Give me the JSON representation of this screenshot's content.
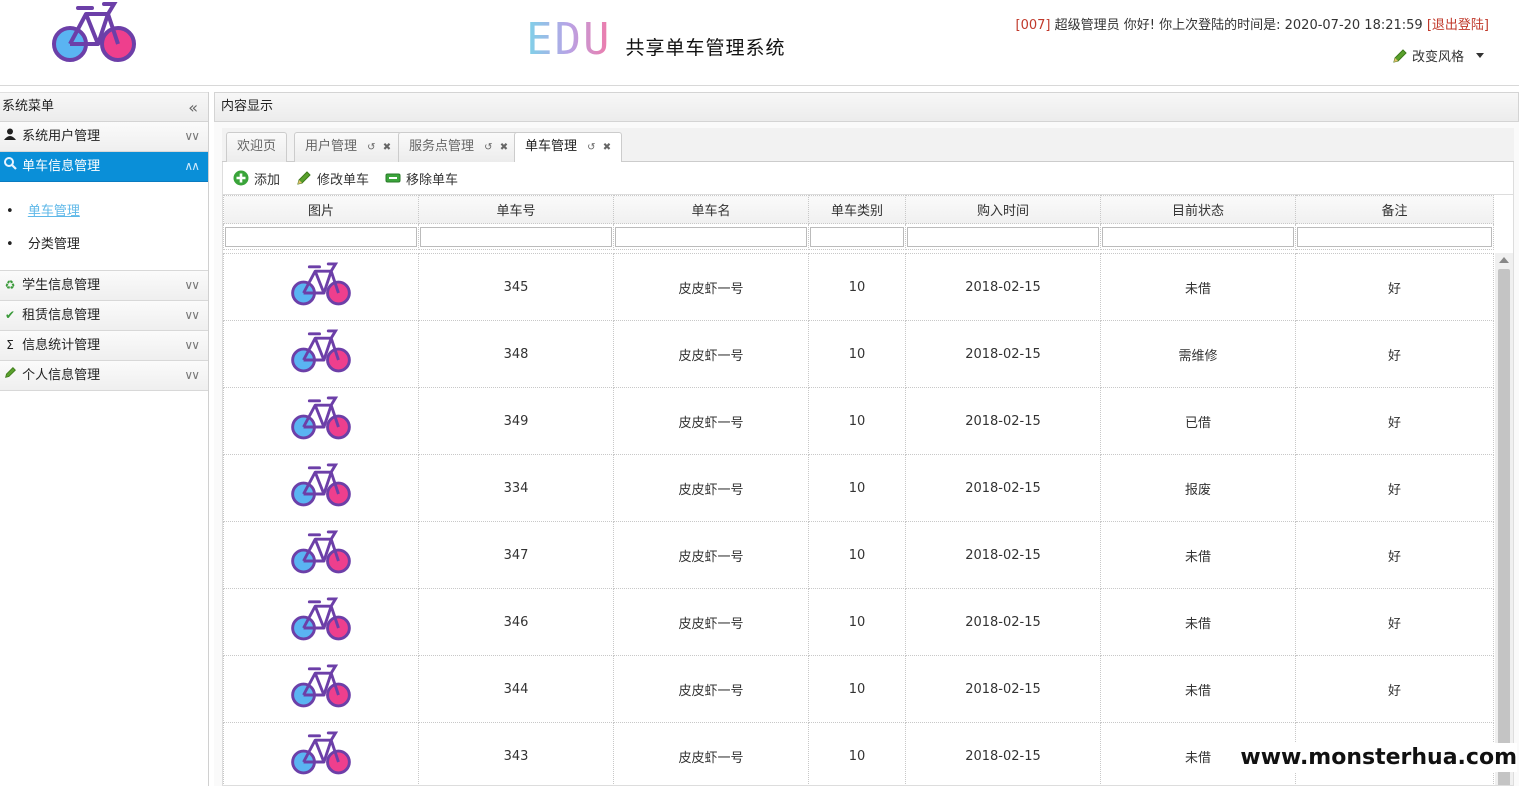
{
  "header": {
    "brand_edu": "EDU",
    "brand_title": "共享单车管理系统",
    "user_id": "[007]",
    "user_greeting": "超级管理员 你好! 你上次登陆的时间是: 2020-07-20 18:21:59",
    "logout_label": "[退出登陆]",
    "style_label": "改变风格"
  },
  "sidebar": {
    "title": "系统菜单",
    "items": [
      {
        "label": "系统用户管理",
        "icon": "user-icon"
      },
      {
        "label": "单车信息管理",
        "icon": "search-icon"
      },
      {
        "label": "学生信息管理",
        "icon": "refresh-icon"
      },
      {
        "label": "租赁信息管理",
        "icon": "check-icon"
      },
      {
        "label": "信息统计管理",
        "icon": "sigma-icon"
      },
      {
        "label": "个人信息管理",
        "icon": "pencil-icon"
      }
    ],
    "submenu": [
      {
        "label": "单车管理"
      },
      {
        "label": "分类管理"
      }
    ]
  },
  "content": {
    "title": "内容显示",
    "tabs": [
      {
        "label": "欢迎页"
      },
      {
        "label": "用户管理"
      },
      {
        "label": "服务点管理"
      },
      {
        "label": "单车管理"
      }
    ],
    "toolbar": {
      "add_label": "添加",
      "edit_label": "修改单车",
      "remove_label": "移除单车"
    },
    "columns": [
      "图片",
      "单车号",
      "单车名",
      "单车类别",
      "购入时间",
      "目前状态",
      "备注"
    ],
    "rows": [
      {
        "id": "345",
        "name": "皮皮虾一号",
        "category": "10",
        "date": "2018-02-15",
        "status": "未借",
        "status_type": "green",
        "note": "好"
      },
      {
        "id": "348",
        "name": "皮皮虾一号",
        "category": "10",
        "date": "2018-02-15",
        "status": "需维修",
        "status_type": "red",
        "note": "好"
      },
      {
        "id": "349",
        "name": "皮皮虾一号",
        "category": "10",
        "date": "2018-02-15",
        "status": "已借",
        "status_type": "red",
        "note": "好"
      },
      {
        "id": "334",
        "name": "皮皮虾一号",
        "category": "10",
        "date": "2018-02-15",
        "status": "报废",
        "status_type": "red",
        "note": "好"
      },
      {
        "id": "347",
        "name": "皮皮虾一号",
        "category": "10",
        "date": "2018-02-15",
        "status": "未借",
        "status_type": "green",
        "note": "好"
      },
      {
        "id": "346",
        "name": "皮皮虾一号",
        "category": "10",
        "date": "2018-02-15",
        "status": "未借",
        "status_type": "green",
        "note": "好"
      },
      {
        "id": "344",
        "name": "皮皮虾一号",
        "category": "10",
        "date": "2018-02-15",
        "status": "未借",
        "status_type": "green",
        "note": "好"
      },
      {
        "id": "343",
        "name": "皮皮虾一号",
        "category": "10",
        "date": "2018-02-15",
        "status": "未借",
        "status_type": "green",
        "note": ""
      }
    ]
  },
  "watermark": "www.monsterhua.com",
  "colors": {
    "accent": "#0a8fd8",
    "status_green": "#2e8b2e",
    "status_red": "#c0392b"
  }
}
